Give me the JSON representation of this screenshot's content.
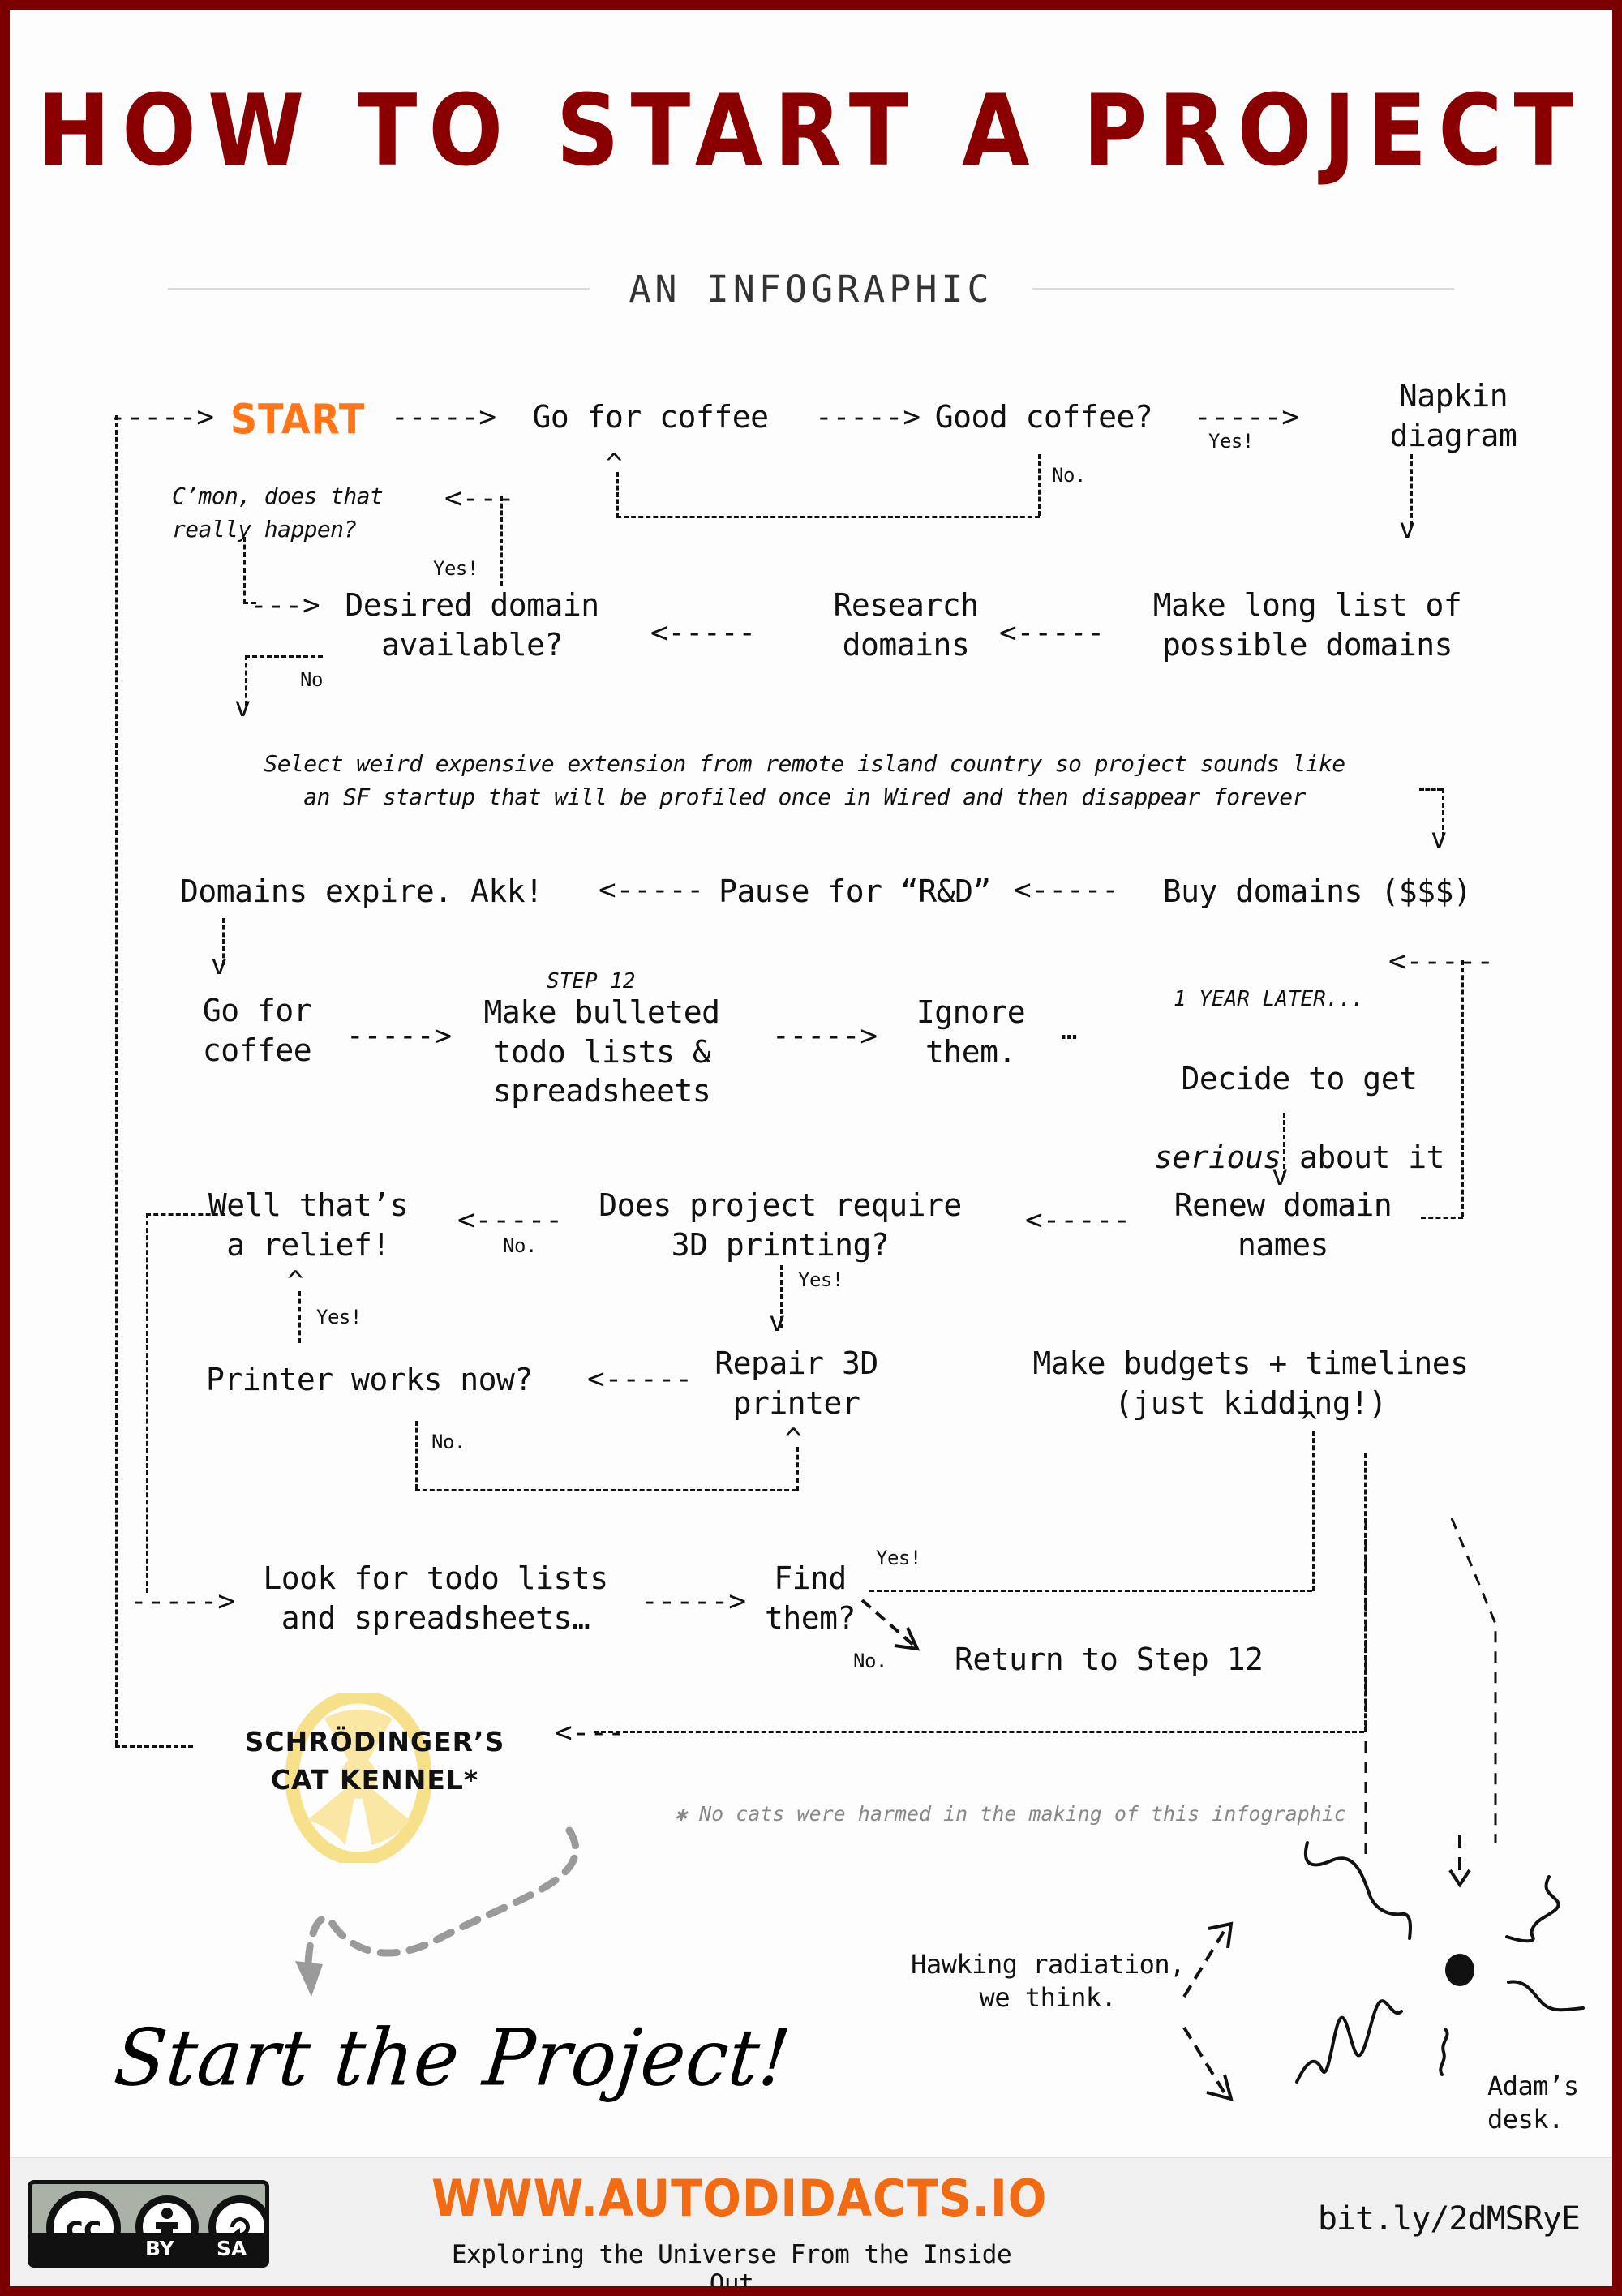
{
  "header": {
    "title": "HOW TO START A PROJECT",
    "subtitle": "AN INFOGRAPHIC"
  },
  "colors": {
    "border": "#7a0000",
    "title": "#8a0000",
    "accent_orange": "#ff7518",
    "brand_orange": "#f26a11",
    "radiation_yellow": "#f7e08a",
    "footnote_gray": "#888888"
  },
  "flow": {
    "start": "START",
    "nodes": {
      "go_for_coffee": "Go for coffee",
      "good_coffee": "Good coffee?",
      "napkin_diagram": "Napkin\ndiagram",
      "cmon_really": "C’mon, does that\nreally happen?",
      "desired_domain": "Desired domain\navailable?",
      "research_domains": "Research\ndomains",
      "make_long_list": "Make long list of\npossible domains",
      "select_weird_extension": "Select weird expensive extension from remote island country so project sounds like\nan SF startup that will be profiled once in Wired and then disappear forever",
      "domains_expire": "Domains expire. Akk!",
      "pause_rd": "Pause for “R&D”",
      "buy_domains": "Buy domains ($$$)",
      "go_for_coffee_2": "Go for\ncoffee",
      "make_bulleted": "Make bulleted\ntodo lists &\nspreadsheets",
      "ignore_them": "Ignore\nthem.",
      "decide_serious_pre": "Decide to get",
      "decide_serious_em": "serious",
      "decide_serious_post": " about it",
      "renew_domain": "Renew domain\nnames",
      "does_3d_printing": "Does project require\n3D printing?",
      "well_relief": "Well that’s\na relief!",
      "printer_works": "Printer works now?",
      "repair_printer": "Repair 3D\nprinter",
      "make_budgets": "Make budgets + timelines\n(just kidding!)",
      "look_for_todo": "Look for todo lists\nand spreadsheets…",
      "find_them": "Find\nthem?",
      "return_step12": "Return to Step 12",
      "schrodinger_kennel": "SCHRÖDINGER’S\nCAT KENNEL*",
      "start_the_project": "Start the Project!",
      "hawking": "Hawking radiation,\nwe think.",
      "adams_desk": "Adam’s\ndesk."
    },
    "edge_labels": {
      "yes_coffee": "Yes!",
      "no_coffee": "No.",
      "yes_cmon": "Yes!",
      "no_domain": "No",
      "step12": "STEP 12",
      "one_year_later": "1 YEAR LATER...",
      "ellipsis": "…",
      "no_3d": "No.",
      "yes_3d": "Yes!",
      "yes_printer": "Yes!",
      "no_printer": "No.",
      "yes_find": "Yes!",
      "no_find": "No."
    },
    "arrows": {
      "right": "----->",
      "left": "<-----",
      "right_short": "--->",
      "left_short": "<---",
      "down": "v",
      "up": "^"
    }
  },
  "footnote": "✱ No cats were harmed in the making of this infographic",
  "footer": {
    "cc": {
      "mark": "cc",
      "by": "BY",
      "sa": "SA"
    },
    "url": "WWW.AUTODIDACTS.IO",
    "tagline": "Exploring the Universe From the Inside Out",
    "short_link": "bit.ly/2dMSRyE"
  }
}
